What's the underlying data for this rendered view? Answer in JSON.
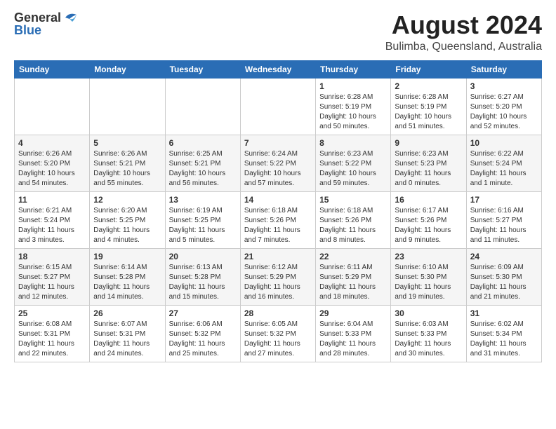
{
  "logo": {
    "line1": "General",
    "line2": "Blue"
  },
  "title": "August 2024",
  "subtitle": "Bulimba, Queensland, Australia",
  "weekdays": [
    "Sunday",
    "Monday",
    "Tuesday",
    "Wednesday",
    "Thursday",
    "Friday",
    "Saturday"
  ],
  "weeks": [
    [
      {
        "day": "",
        "info": ""
      },
      {
        "day": "",
        "info": ""
      },
      {
        "day": "",
        "info": ""
      },
      {
        "day": "",
        "info": ""
      },
      {
        "day": "1",
        "info": "Sunrise: 6:28 AM\nSunset: 5:19 PM\nDaylight: 10 hours\nand 50 minutes."
      },
      {
        "day": "2",
        "info": "Sunrise: 6:28 AM\nSunset: 5:19 PM\nDaylight: 10 hours\nand 51 minutes."
      },
      {
        "day": "3",
        "info": "Sunrise: 6:27 AM\nSunset: 5:20 PM\nDaylight: 10 hours\nand 52 minutes."
      }
    ],
    [
      {
        "day": "4",
        "info": "Sunrise: 6:26 AM\nSunset: 5:20 PM\nDaylight: 10 hours\nand 54 minutes."
      },
      {
        "day": "5",
        "info": "Sunrise: 6:26 AM\nSunset: 5:21 PM\nDaylight: 10 hours\nand 55 minutes."
      },
      {
        "day": "6",
        "info": "Sunrise: 6:25 AM\nSunset: 5:21 PM\nDaylight: 10 hours\nand 56 minutes."
      },
      {
        "day": "7",
        "info": "Sunrise: 6:24 AM\nSunset: 5:22 PM\nDaylight: 10 hours\nand 57 minutes."
      },
      {
        "day": "8",
        "info": "Sunrise: 6:23 AM\nSunset: 5:22 PM\nDaylight: 10 hours\nand 59 minutes."
      },
      {
        "day": "9",
        "info": "Sunrise: 6:23 AM\nSunset: 5:23 PM\nDaylight: 11 hours\nand 0 minutes."
      },
      {
        "day": "10",
        "info": "Sunrise: 6:22 AM\nSunset: 5:24 PM\nDaylight: 11 hours\nand 1 minute."
      }
    ],
    [
      {
        "day": "11",
        "info": "Sunrise: 6:21 AM\nSunset: 5:24 PM\nDaylight: 11 hours\nand 3 minutes."
      },
      {
        "day": "12",
        "info": "Sunrise: 6:20 AM\nSunset: 5:25 PM\nDaylight: 11 hours\nand 4 minutes."
      },
      {
        "day": "13",
        "info": "Sunrise: 6:19 AM\nSunset: 5:25 PM\nDaylight: 11 hours\nand 5 minutes."
      },
      {
        "day": "14",
        "info": "Sunrise: 6:18 AM\nSunset: 5:26 PM\nDaylight: 11 hours\nand 7 minutes."
      },
      {
        "day": "15",
        "info": "Sunrise: 6:18 AM\nSunset: 5:26 PM\nDaylight: 11 hours\nand 8 minutes."
      },
      {
        "day": "16",
        "info": "Sunrise: 6:17 AM\nSunset: 5:26 PM\nDaylight: 11 hours\nand 9 minutes."
      },
      {
        "day": "17",
        "info": "Sunrise: 6:16 AM\nSunset: 5:27 PM\nDaylight: 11 hours\nand 11 minutes."
      }
    ],
    [
      {
        "day": "18",
        "info": "Sunrise: 6:15 AM\nSunset: 5:27 PM\nDaylight: 11 hours\nand 12 minutes."
      },
      {
        "day": "19",
        "info": "Sunrise: 6:14 AM\nSunset: 5:28 PM\nDaylight: 11 hours\nand 14 minutes."
      },
      {
        "day": "20",
        "info": "Sunrise: 6:13 AM\nSunset: 5:28 PM\nDaylight: 11 hours\nand 15 minutes."
      },
      {
        "day": "21",
        "info": "Sunrise: 6:12 AM\nSunset: 5:29 PM\nDaylight: 11 hours\nand 16 minutes."
      },
      {
        "day": "22",
        "info": "Sunrise: 6:11 AM\nSunset: 5:29 PM\nDaylight: 11 hours\nand 18 minutes."
      },
      {
        "day": "23",
        "info": "Sunrise: 6:10 AM\nSunset: 5:30 PM\nDaylight: 11 hours\nand 19 minutes."
      },
      {
        "day": "24",
        "info": "Sunrise: 6:09 AM\nSunset: 5:30 PM\nDaylight: 11 hours\nand 21 minutes."
      }
    ],
    [
      {
        "day": "25",
        "info": "Sunrise: 6:08 AM\nSunset: 5:31 PM\nDaylight: 11 hours\nand 22 minutes."
      },
      {
        "day": "26",
        "info": "Sunrise: 6:07 AM\nSunset: 5:31 PM\nDaylight: 11 hours\nand 24 minutes."
      },
      {
        "day": "27",
        "info": "Sunrise: 6:06 AM\nSunset: 5:32 PM\nDaylight: 11 hours\nand 25 minutes."
      },
      {
        "day": "28",
        "info": "Sunrise: 6:05 AM\nSunset: 5:32 PM\nDaylight: 11 hours\nand 27 minutes."
      },
      {
        "day": "29",
        "info": "Sunrise: 6:04 AM\nSunset: 5:33 PM\nDaylight: 11 hours\nand 28 minutes."
      },
      {
        "day": "30",
        "info": "Sunrise: 6:03 AM\nSunset: 5:33 PM\nDaylight: 11 hours\nand 30 minutes."
      },
      {
        "day": "31",
        "info": "Sunrise: 6:02 AM\nSunset: 5:34 PM\nDaylight: 11 hours\nand 31 minutes."
      }
    ]
  ]
}
